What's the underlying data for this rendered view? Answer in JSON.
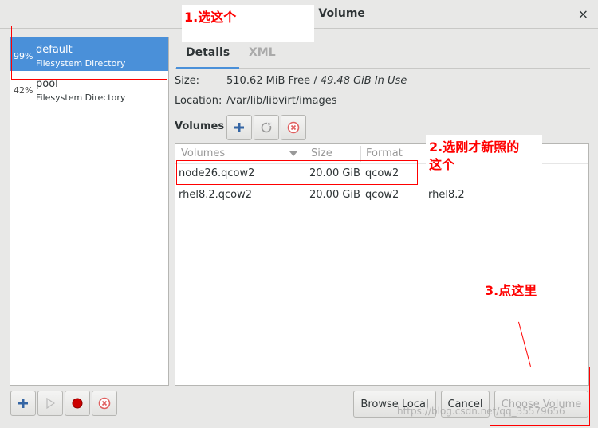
{
  "window": {
    "title": "e Volume",
    "close_glyph": "×"
  },
  "pools": [
    {
      "percent": "99%",
      "name": "default",
      "type": "Filesystem Directory",
      "selected": true
    },
    {
      "percent": "42%",
      "name": "pool",
      "type": "Filesystem Directory",
      "selected": false
    }
  ],
  "tabs": [
    {
      "label": "Details",
      "active": true
    },
    {
      "label": "XML",
      "active": false
    }
  ],
  "details": {
    "size_label": "Size:",
    "size_free": "510.62 MiB Free /",
    "size_used": "49.48 GiB In Use",
    "location_label": "Location:",
    "location_value": "/var/lib/libvirt/images"
  },
  "volumes_section": {
    "label": "Volumes",
    "toolbar_icons": [
      "add-icon",
      "refresh-icon",
      "delete-icon"
    ]
  },
  "table": {
    "columns": [
      "Volumes",
      "Size",
      "Format"
    ],
    "rows": [
      {
        "name": "node26.qcow2",
        "size": "20.00 GiB",
        "format": "qcow2",
        "used_by": ""
      },
      {
        "name": "rhel8.2.qcow2",
        "size": "20.00 GiB",
        "format": "qcow2",
        "used_by": "rhel8.2"
      }
    ]
  },
  "bottom_left_icons": [
    "add-icon",
    "play-icon",
    "record-icon",
    "delete-icon"
  ],
  "buttons": {
    "browse_local": "Browse Local",
    "cancel": "Cancel",
    "choose_volume": "Choose Volume"
  },
  "annotations": {
    "step1": "1.选这个",
    "step2_line1": "2.选刚才新照的",
    "step2_line2": "这个",
    "step3": "3.点这里"
  },
  "watermark": "https://blog.csdn.net/qq_35579656",
  "colors": {
    "selection": "#4a90d9",
    "annotation": "#ff0000"
  }
}
